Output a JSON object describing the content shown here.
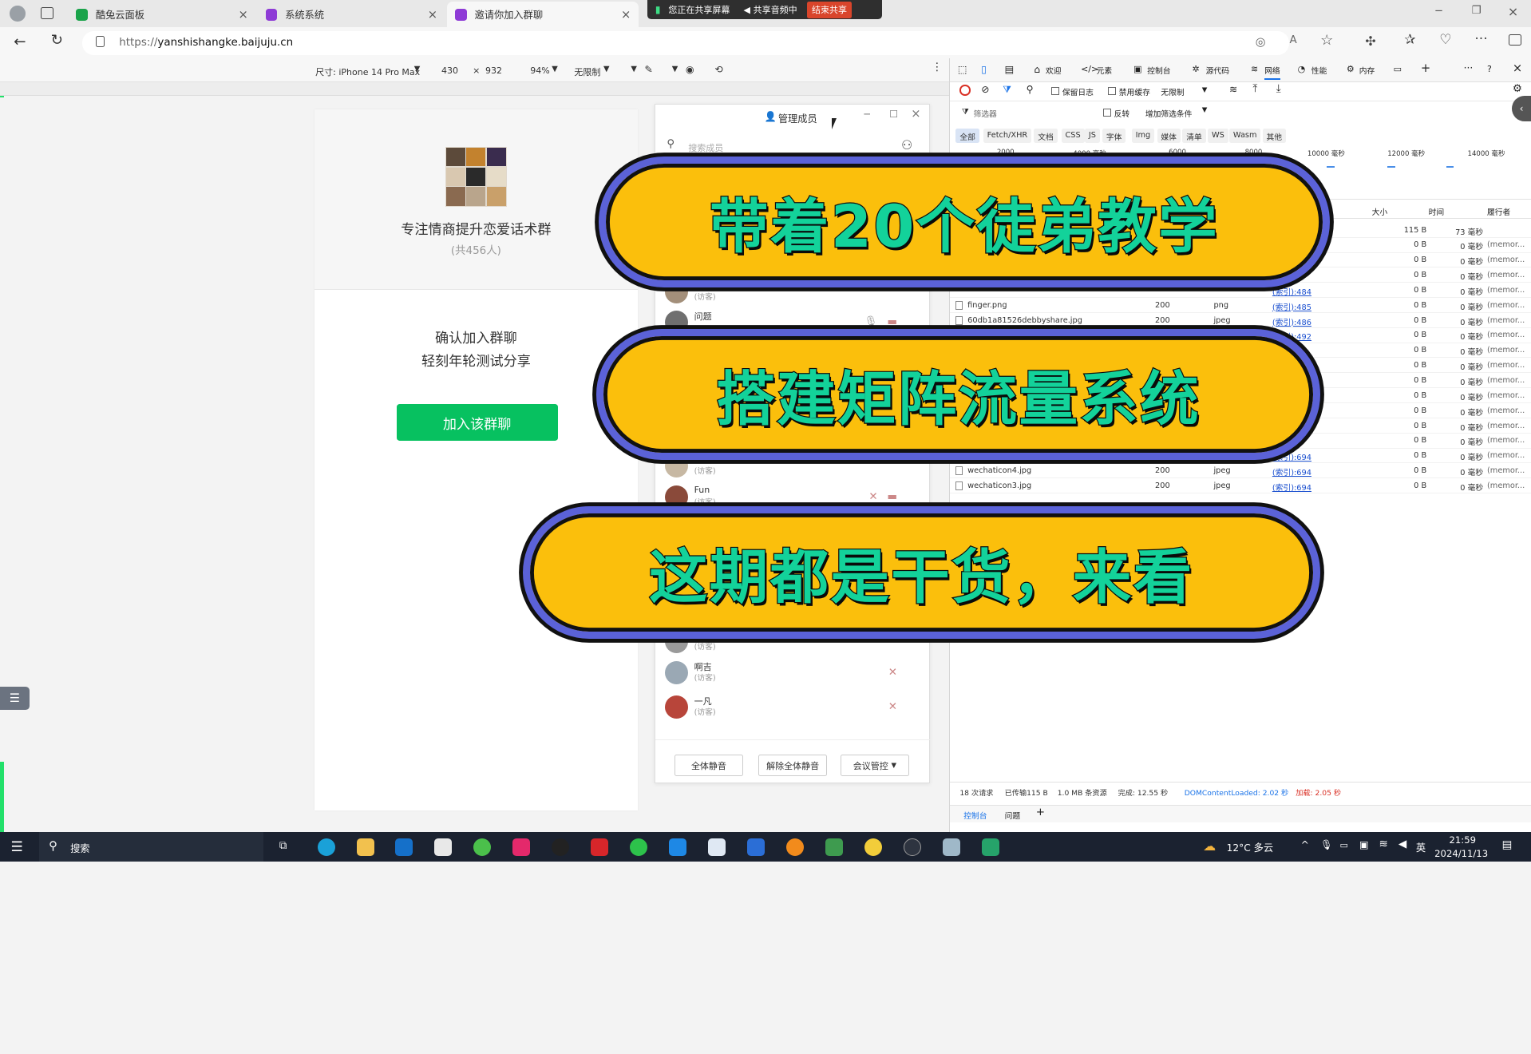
{
  "browser": {
    "tabs": [
      {
        "title": "酷兔云面板",
        "color": "#1aa34a"
      },
      {
        "title": "系统系统",
        "color": "#8e3bd6"
      },
      {
        "title": "邀请你加入群聊",
        "color": "#8e3bd6"
      }
    ],
    "share_bar": {
      "status": "您正在共享屏幕",
      "audio": "共享音频中",
      "stop": "结束共享"
    },
    "url_prefix": "https://",
    "url_host": "yanshishangke.baijuju.cn"
  },
  "emulation": {
    "device": "尺寸: iPhone 14 Pro Max",
    "width": "430",
    "times": "×",
    "height": "932",
    "zoom": "94%",
    "throttle": "无限制"
  },
  "page": {
    "group_name": "专注情商提升恋爱话术群",
    "member_count": "(共456人)",
    "confirm_line1": "确认加入群聊",
    "confirm_line2": "轻刻年轮测试分享",
    "join_button": "加入该群聊"
  },
  "members_dialog": {
    "title": "管理成员",
    "search_placeholder": "搜索成员",
    "members": [
      {
        "name": "",
        "role": "(访客)",
        "avatar": "#a38f7a"
      },
      {
        "name": "问题",
        "role": "",
        "avatar": "#6f6f6f"
      },
      {
        "name": "",
        "role": "(访客)",
        "avatar": "#c7b8a3"
      },
      {
        "name": "Fun",
        "role": "(访客)",
        "avatar": "#8a4a3a"
      },
      {
        "name": "",
        "role": "(访客)",
        "avatar": "#9a9a9a"
      },
      {
        "name": "啊吉",
        "role": "(访客)",
        "avatar": "#9aa8b4"
      },
      {
        "name": "一凡",
        "role": "(访客)",
        "avatar": "#b8453a"
      }
    ],
    "mute_all": "全体静音",
    "unmute_all": "解除全体静音",
    "meeting_control": "会议管控"
  },
  "devtools": {
    "tabs": [
      "欢迎",
      "元素",
      "控制台",
      "源代码",
      "网络",
      "性能",
      "内存"
    ],
    "active_tab": "网络",
    "options": {
      "preserve_log": "保留日志",
      "disable_cache": "禁用缓存",
      "throttle": "无限制"
    },
    "filter_placeholder": "筛选器",
    "invert": "反转",
    "more_filters": "增加筛选条件",
    "filter_types": [
      "全部",
      "Fetch/XHR",
      "文档",
      "CSS",
      "JS",
      "字体",
      "Img",
      "媒体",
      "清单",
      "WS",
      "Wasm",
      "其他"
    ],
    "timeline_ticks": [
      "2000",
      "4000 毫秒",
      "6000",
      "8000",
      "10000 毫秒",
      "12000 毫秒",
      "14000 毫秒"
    ],
    "columns": {
      "size": "大小",
      "time": "时间",
      "fulfilled_by": "履行者"
    },
    "rows": [
      {
        "name": "",
        "status": "",
        "type": "",
        "initiator": "",
        "size": "115 B",
        "time": "73 毫秒",
        "fulfilled": ""
      },
      {
        "name": "",
        "status": "",
        "type": "",
        "initiator": "",
        "size": "0 B",
        "time": "0 毫秒",
        "fulfilled": "(memor..."
      },
      {
        "name": "",
        "status": "",
        "type": "",
        "initiator": "",
        "size": "0 B",
        "time": "0 毫秒",
        "fulfilled": "(memor..."
      },
      {
        "name": "",
        "status": "",
        "type": "",
        "initiator": "",
        "size": "0 B",
        "time": "0 毫秒",
        "fulfilled": "(memor..."
      },
      {
        "name": "",
        "status": "",
        "type": "",
        "initiator": "(索引):484",
        "size": "0 B",
        "time": "0 毫秒",
        "fulfilled": "(memor..."
      },
      {
        "name": "finger.png",
        "status": "200",
        "type": "png",
        "initiator": "(索引):485",
        "size": "0 B",
        "time": "0 毫秒",
        "fulfilled": "(memor..."
      },
      {
        "name": "60db1a81526debbyshare.jpg",
        "status": "200",
        "type": "jpeg",
        "initiator": "(索引):486",
        "size": "0 B",
        "time": "0 毫秒",
        "fulfilled": "(memor..."
      },
      {
        "name": "",
        "status": "",
        "type": "",
        "initiator": "(索引):492",
        "size": "0 B",
        "time": "0 毫秒",
        "fulfilled": "(memor..."
      },
      {
        "name": "",
        "status": "",
        "type": "",
        "initiator": "",
        "size": "0 B",
        "time": "0 毫秒",
        "fulfilled": "(memor..."
      },
      {
        "name": "",
        "status": "",
        "type": "",
        "initiator": "",
        "size": "0 B",
        "time": "0 毫秒",
        "fulfilled": "(memor..."
      },
      {
        "name": "",
        "status": "",
        "type": "",
        "initiator": "",
        "size": "0 B",
        "time": "0 毫秒",
        "fulfilled": "(memor..."
      },
      {
        "name": "",
        "status": "",
        "type": "",
        "initiator": "",
        "size": "0 B",
        "time": "0 毫秒",
        "fulfilled": "(memor..."
      },
      {
        "name": "",
        "status": "",
        "type": "",
        "initiator": "",
        "size": "0 B",
        "time": "0 毫秒",
        "fulfilled": "(memor..."
      },
      {
        "name": "",
        "status": "",
        "type": "",
        "initiator": "",
        "size": "0 B",
        "time": "0 毫秒",
        "fulfilled": "(memor..."
      },
      {
        "name": "",
        "status": "",
        "type": "",
        "initiator": "",
        "size": "0 B",
        "time": "0 毫秒",
        "fulfilled": "(memor..."
      },
      {
        "name": "",
        "status": "",
        "type": "",
        "initiator": "(索引):694",
        "size": "0 B",
        "time": "0 毫秒",
        "fulfilled": "(memor..."
      },
      {
        "name": "wechaticon4.jpg",
        "status": "200",
        "type": "jpeg",
        "initiator": "(索引):694",
        "size": "0 B",
        "time": "0 毫秒",
        "fulfilled": "(memor..."
      },
      {
        "name": "wechaticon3.jpg",
        "status": "200",
        "type": "jpeg",
        "initiator": "(索引):694",
        "size": "0 B",
        "time": "0 毫秒",
        "fulfilled": "(memor..."
      }
    ],
    "status_bar": {
      "requests": "18 次请求",
      "transferred": "已传输115 B",
      "resources": "1.0 MB 条资源",
      "finish": "完成: 12.55 秒",
      "dcl": "DOMContentLoaded: 2.02 秒",
      "load": "加载: 2.05 秒"
    },
    "drawer_tabs": [
      "控制台",
      "问题"
    ]
  },
  "overlay": {
    "banner1": "带着20个徒弟教学",
    "banner2": "搭建矩阵流量系统",
    "banner3": "这期都是干货，来看"
  },
  "taskbar": {
    "search": "搜索",
    "weather": "12°C 多云",
    "ime": "英",
    "time": "21:59",
    "date": "2024/11/13"
  },
  "colors": {
    "banner_fill": "#fbbf0c",
    "banner_border": "#5b62d8",
    "banner_text": "#13d29a",
    "wechat_green": "#07c160",
    "frame_green": "#22e06a"
  }
}
